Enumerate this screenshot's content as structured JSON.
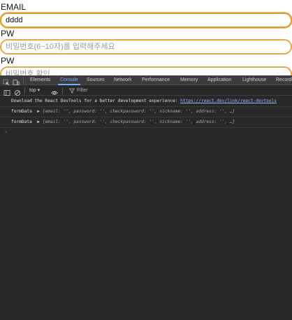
{
  "form": {
    "email_label": "EMAIL",
    "email_value": "dddd",
    "pw_label": "PW",
    "pw_placeholder": "비밀번호(6~10자)를 입력해주세요",
    "pw_confirm_label": "PW",
    "pw_confirm_placeholder": "비밀번호 확인"
  },
  "devtools": {
    "tabs": [
      "Elements",
      "Console",
      "Sources",
      "Network",
      "Performance",
      "Memory",
      "Application",
      "Lighthouse",
      "Recorder"
    ],
    "active_tab": "Console",
    "context": "top ▾",
    "filter_placeholder": "Filter",
    "messages": [
      {
        "text": "Download the React DevTools for a better development experience: ",
        "link": "https://react.dev/link/react-devtools"
      },
      {
        "key": "formData",
        "object": "{email: '', password: '', checkpassword: '', nickname: '', address: '', …}"
      },
      {
        "key": "formData",
        "object": "{email: '', password: '', checkpassword: '', nickname: '', address: '', …}"
      }
    ],
    "prompt": "›"
  },
  "colors": {
    "input_border": "#e6a84a",
    "devtools_bg": "#282828",
    "active_tab": "#7cacf8"
  }
}
